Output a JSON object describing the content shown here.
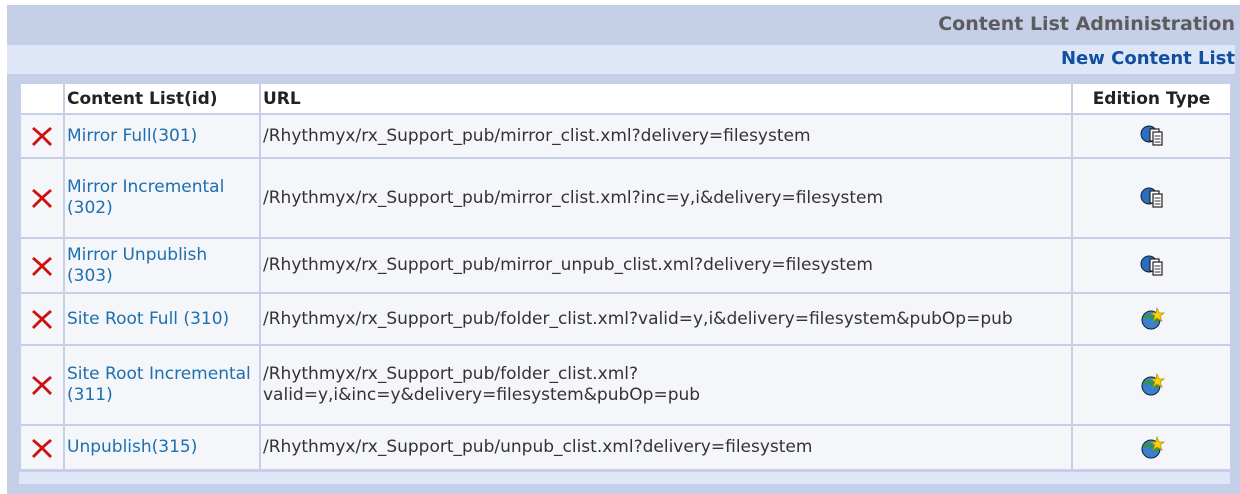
{
  "header": {
    "title": "Content List Administration",
    "new_link": "New Content List"
  },
  "columns": {
    "name": "Content List(id)",
    "url": "URL",
    "edition_type": "Edition Type"
  },
  "rows": [
    {
      "name": "Mirror Full(301)",
      "url": "/Rhythmyx/rx_Support_pub/mirror_clist.xml?delivery=filesystem",
      "edition_icon": "mirror-edition-icon"
    },
    {
      "name": "Mirror Incremental (302)",
      "url": "/Rhythmyx/rx_Support_pub/mirror_clist.xml?inc=y,i&delivery=filesystem",
      "edition_icon": "mirror-edition-icon"
    },
    {
      "name": "Mirror Unpublish (303)",
      "url": "/Rhythmyx/rx_Support_pub/mirror_unpub_clist.xml?delivery=filesystem",
      "edition_icon": "mirror-edition-icon"
    },
    {
      "name": "Site Root Full (310)",
      "url": "/Rhythmyx/rx_Support_pub/folder_clist.xml?valid=y,i&delivery=filesystem&pubOp=pub",
      "edition_icon": "publish-edition-icon"
    },
    {
      "name": "Site Root Incremental (311)",
      "url": "/Rhythmyx/rx_Support_pub/folder_clist.xml?valid=y,i&inc=y&delivery=filesystem&pubOp=pub",
      "edition_icon": "publish-edition-icon"
    },
    {
      "name": "Unpublish(315)",
      "url": "/Rhythmyx/rx_Support_pub/unpub_clist.xml?delivery=filesystem",
      "edition_icon": "publish-edition-icon"
    }
  ],
  "colors": {
    "frame": "#c5cfe8",
    "subbar": "#dfe6f7",
    "link": "#1c6fb0",
    "delete": "#cc1111"
  }
}
